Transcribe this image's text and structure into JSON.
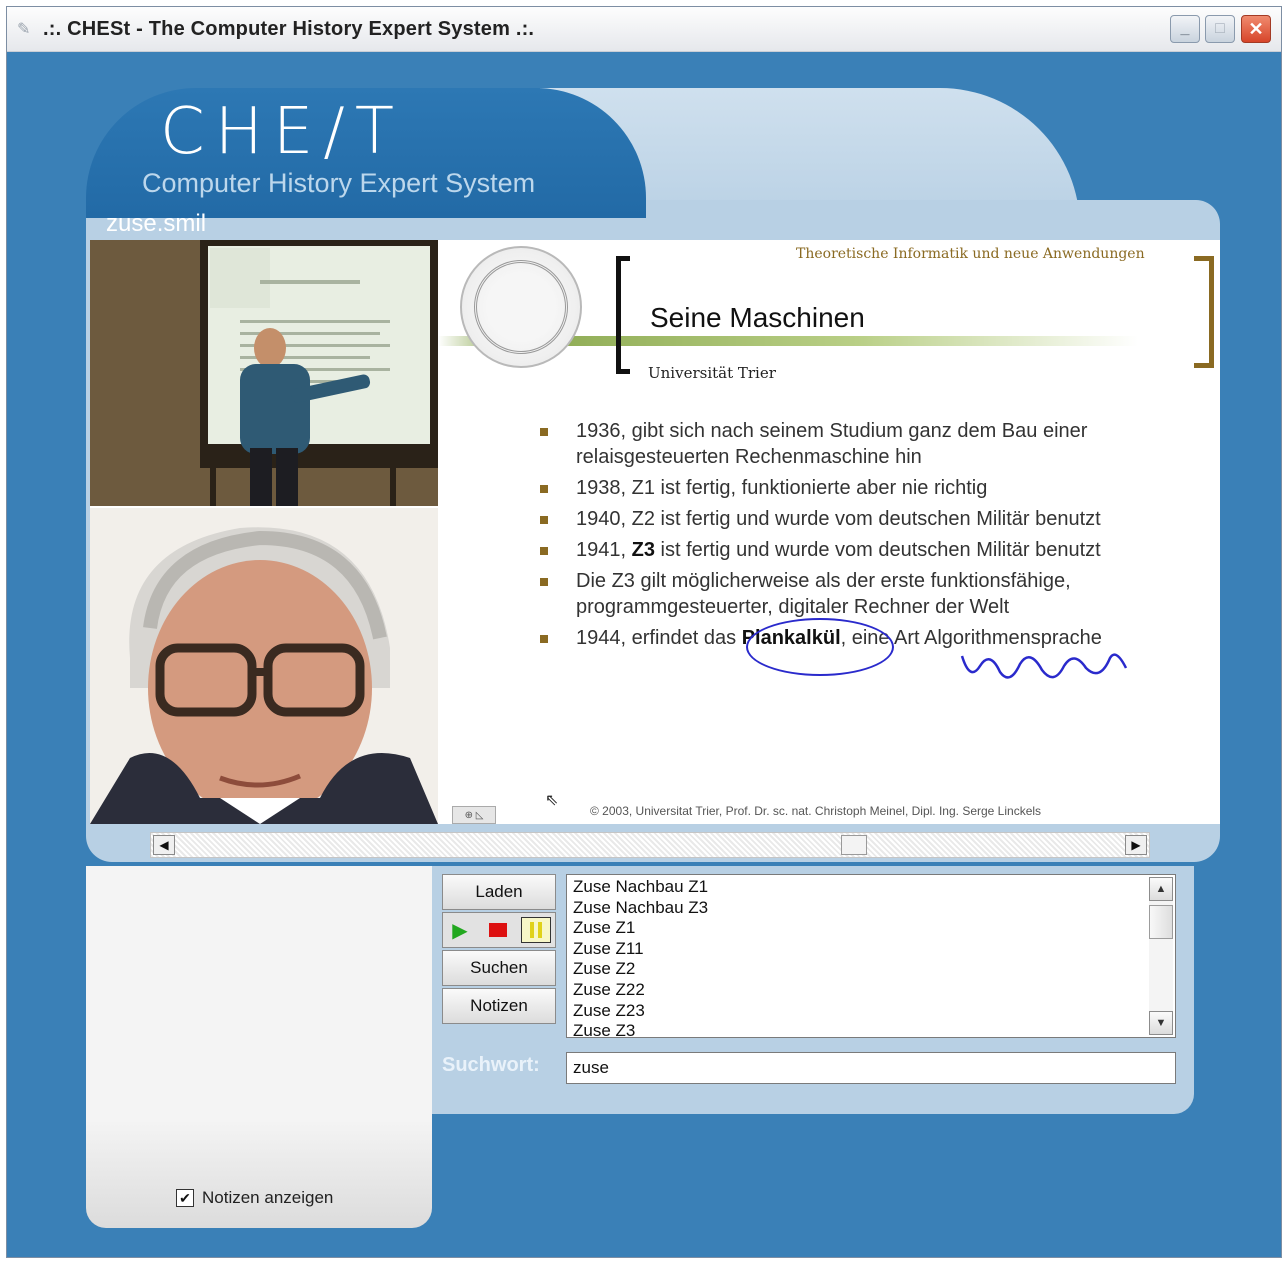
{
  "window": {
    "title": ".:. CHESt - The Computer History Expert System .:.",
    "controls": [
      "minimize",
      "maximize",
      "close"
    ]
  },
  "header": {
    "logo": "CHE∕T",
    "subtitle": "Computer History Expert System",
    "file_name": "zuse.smil"
  },
  "slide": {
    "institute": "Theoretische Informatik und neue Anwendungen",
    "title": "Seine Maschinen",
    "university": "Universität Trier",
    "bullets": [
      {
        "pre": "1936, gibt sich nach seinem Studium ganz dem Bau einer relaisgesteuerten Rechenmaschine hin",
        "bold": "",
        "post": ""
      },
      {
        "pre": "1938, Z1 ist fertig, funktionierte aber nie richtig",
        "bold": "",
        "post": ""
      },
      {
        "pre": "1940, Z2 ist fertig und wurde vom deutschen Militär benutzt",
        "bold": "",
        "post": ""
      },
      {
        "pre": "1941, ",
        "bold": "Z3",
        "post": " ist fertig und wurde vom deutschen Militär benutzt"
      },
      {
        "pre": "Die Z3 gilt möglicherweise als der erste funktionsfähige, programmgesteuerter, digitaler Rechner der Welt",
        "bold": "",
        "post": ""
      },
      {
        "pre": "1944, erfindet das ",
        "bold": "Plankalkül",
        "post": ", eine Art Algorithmensprache"
      }
    ],
    "copyright": "© 2003, Universitat Trier, Prof. Dr. sc. nat. Christoph Meinel, Dipl. Ing. Serge Linckels"
  },
  "controls": {
    "load_label": "Laden",
    "search_label": "Suchen",
    "notes_label": "Notizen",
    "play_icon": "play-icon",
    "stop_icon": "stop-icon",
    "pause_icon": "pause-icon"
  },
  "results": [
    "Zuse Nachbau Z1",
    "Zuse Nachbau Z3",
    "Zuse Z1",
    "Zuse Z11",
    "Zuse Z2",
    "Zuse Z22",
    "Zuse Z23",
    "Zuse Z3"
  ],
  "search": {
    "label": "Suchwort:",
    "value": "zuse"
  },
  "notes_toggle": {
    "label": "Notizen anzeigen",
    "checked": true
  },
  "colors": {
    "background": "#3a80b7",
    "panel": "#b8d0e4",
    "accent_gold": "#8a6a22",
    "accent_green": "#8aa84f",
    "ink_blue": "#2a2acc"
  }
}
